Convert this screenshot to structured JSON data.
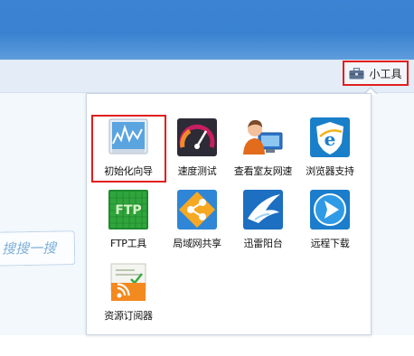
{
  "toolbar": {
    "tools_label": "小工具",
    "tools_icon": "toolbox-icon"
  },
  "search_hint": "搜搜一搜",
  "tools_panel": {
    "items": [
      {
        "label": "初始化向导",
        "icon": "chart-wizard-icon"
      },
      {
        "label": "速度测试",
        "icon": "speedometer-icon"
      },
      {
        "label": "查看室友网速",
        "icon": "roommate-monitor-icon"
      },
      {
        "label": "浏览器支持",
        "icon": "browser-shield-icon"
      },
      {
        "label": "FTP工具",
        "icon": "ftp-icon"
      },
      {
        "label": "局域网共享",
        "icon": "share-icon"
      },
      {
        "label": "迅雷阳台",
        "icon": "thunder-bird-icon"
      },
      {
        "label": "远程下载",
        "icon": "remote-download-icon"
      },
      {
        "label": "资源订阅器",
        "icon": "rss-feed-icon"
      }
    ]
  },
  "colors": {
    "header": "#3a82d1",
    "highlight": "#e0201c",
    "popup_border": "#c9d5e3"
  }
}
